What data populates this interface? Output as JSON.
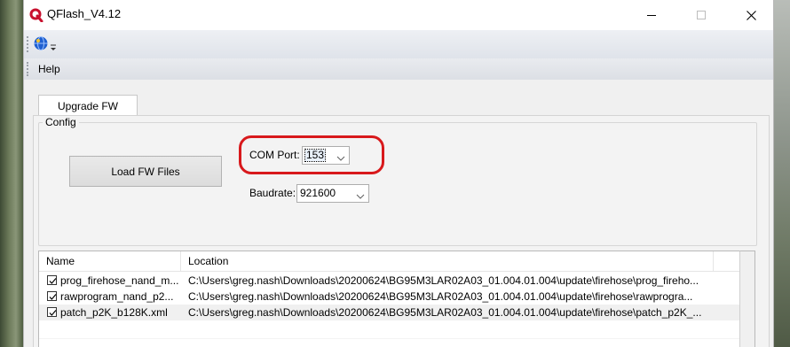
{
  "window": {
    "title": "QFlash_V4.12",
    "icon": "qflash-logo-icon",
    "controls": [
      "minimize-icon",
      "maximize-icon",
      "close-icon"
    ]
  },
  "toolbar": {
    "icon": "globe-help-icon"
  },
  "menubar": {
    "items": [
      {
        "label": "Help"
      }
    ]
  },
  "tabs": [
    {
      "label": "Upgrade FW",
      "active": true
    }
  ],
  "config": {
    "legend": "Config",
    "load_button": "Load FW Files",
    "com_port": {
      "label": "COM Port:",
      "value": "153"
    },
    "baudrate": {
      "label": "Baudrate:",
      "value": "921600"
    },
    "highlight_color": "#d8191c"
  },
  "file_list": {
    "columns": [
      "Name",
      "Location"
    ],
    "rows": [
      {
        "checked": true,
        "name": "prog_firehose_nand_m...",
        "location": "C:\\Users\\greg.nash\\Downloads\\20200624\\BG95M3LAR02A03_01.004.01.004\\update\\firehose\\prog_fireho..."
      },
      {
        "checked": true,
        "name": "rawprogram_nand_p2...",
        "location": "C:\\Users\\greg.nash\\Downloads\\20200624\\BG95M3LAR02A03_01.004.01.004\\update\\firehose\\rawprogra..."
      },
      {
        "checked": true,
        "name": "patch_p2K_b128K.xml",
        "location": "C:\\Users\\greg.nash\\Downloads\\20200624\\BG95M3LAR02A03_01.004.01.004\\update\\firehose\\patch_p2K_..."
      }
    ]
  }
}
